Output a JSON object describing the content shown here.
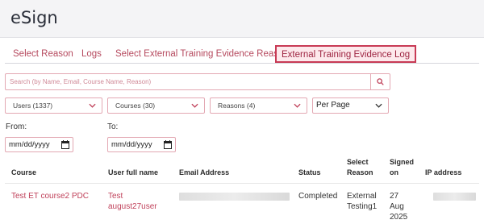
{
  "app": {
    "title": "eSign"
  },
  "tabs": [
    {
      "label": "Select Reason"
    },
    {
      "label": "Logs"
    },
    {
      "label": "Select External Training Evidence Reason"
    },
    {
      "label": "External Training Evidence Log",
      "active": true
    }
  ],
  "search": {
    "placeholder": "Search (by Name, Email, Course Name, Reason)",
    "value": ""
  },
  "filters": {
    "users": "Users (1337)",
    "courses": "Courses (30)",
    "reasons": "Reasons (4)",
    "per_page": "Per Page"
  },
  "dates": {
    "from_label": "From:",
    "to_label": "To:",
    "from_placeholder": "mm/dd/yyyy",
    "to_placeholder": "mm/dd/yyyy"
  },
  "table": {
    "headers": {
      "course": "Course",
      "user": "User full name",
      "email": "Email Address",
      "status": "Status",
      "reason_1": "Select",
      "reason_2": "Reason",
      "signed_1": "Signed",
      "signed_2": "on",
      "ip": "IP address"
    },
    "rows": [
      {
        "course": "Test ET course2 PDC",
        "user_1": "Test",
        "user_2": "august27user",
        "status": "Completed",
        "reason_1": "External",
        "reason_2": "Testing1",
        "signed_1": "27",
        "signed_2": "Aug",
        "signed_3": "2025"
      }
    ]
  },
  "colors": {
    "accent": "#c0415a",
    "border": "#e3a8b3",
    "header_bg": "#f4f4f6"
  }
}
